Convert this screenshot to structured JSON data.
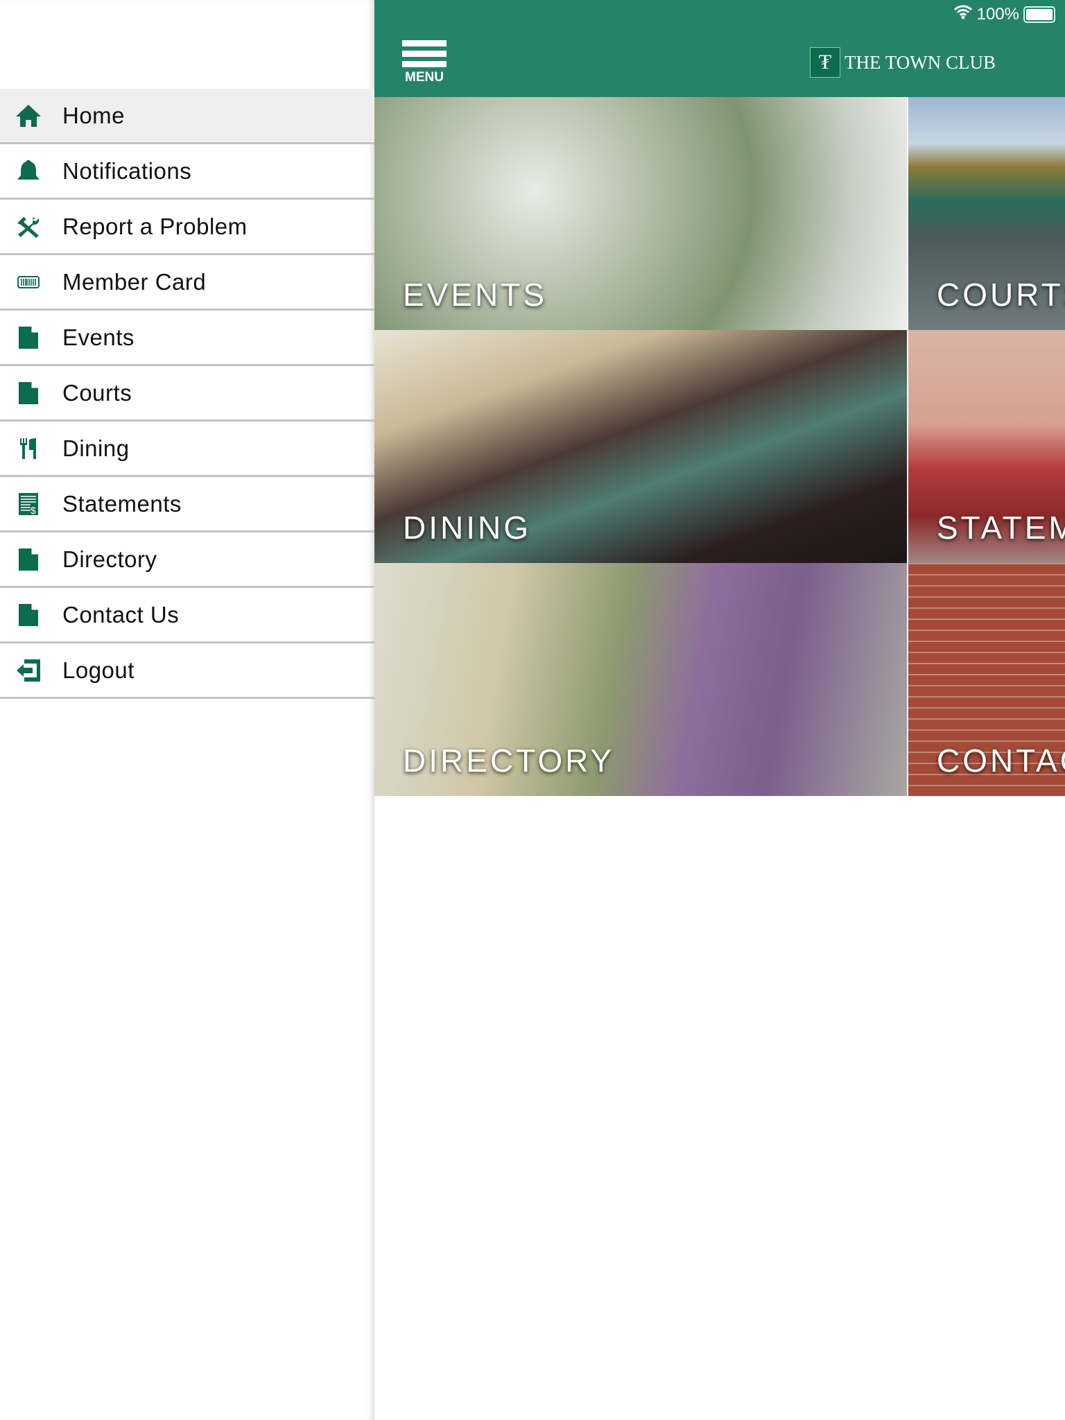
{
  "status_bar": {
    "battery": "100%",
    "icons": [
      "wifi-icon",
      "battery-icon"
    ]
  },
  "header": {
    "menu_label": "MENU",
    "logo_mark": "TC",
    "logo_text": "THE TOWN CLUB",
    "color": "#25826b"
  },
  "sidebar": {
    "items": [
      {
        "label": "Home",
        "icon": "home-icon",
        "active": true
      },
      {
        "label": "Notifications",
        "icon": "bell-icon"
      },
      {
        "label": "Report a Problem",
        "icon": "tools-icon"
      },
      {
        "label": "Member Card",
        "icon": "barcode-icon"
      },
      {
        "label": "Events",
        "icon": "document-icon"
      },
      {
        "label": "Courts",
        "icon": "document-icon"
      },
      {
        "label": "Dining",
        "icon": "utensils-icon"
      },
      {
        "label": "Statements",
        "icon": "statement-icon"
      },
      {
        "label": "Directory",
        "icon": "document-icon"
      },
      {
        "label": "Contact Us",
        "icon": "document-icon"
      },
      {
        "label": "Logout",
        "icon": "logout-icon"
      }
    ],
    "icon_color": "#0d6b4f"
  },
  "tiles": [
    {
      "label": "EVENTS"
    },
    {
      "label": "COURTS"
    },
    {
      "label": "DINING"
    },
    {
      "label": "STATEMENTS"
    },
    {
      "label": "DIRECTORY"
    },
    {
      "label": "CONTACT"
    }
  ]
}
